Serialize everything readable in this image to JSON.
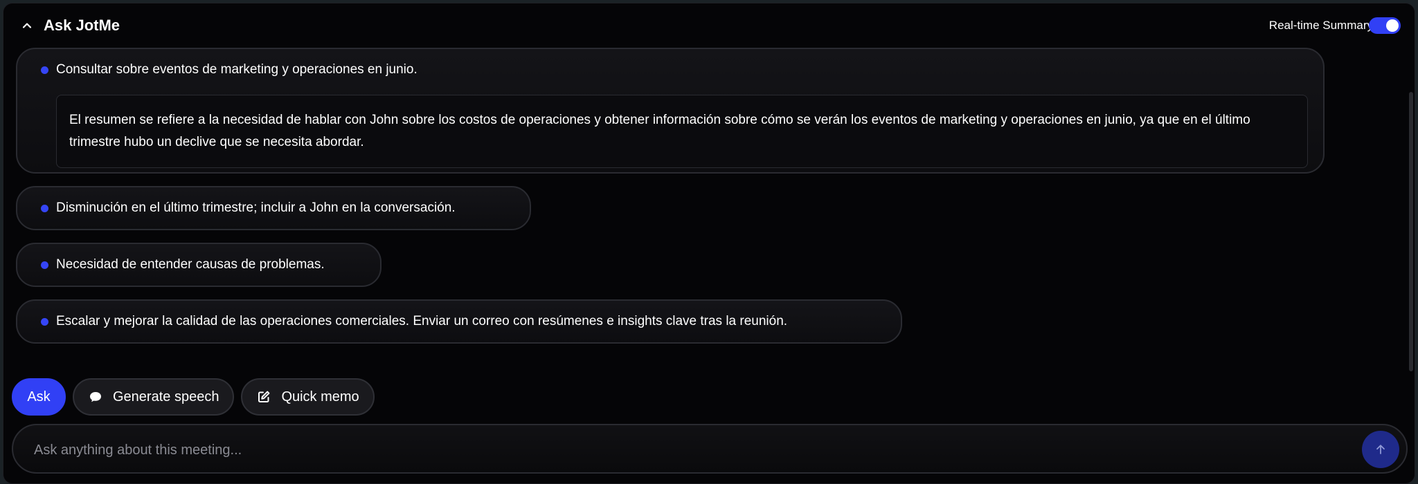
{
  "header": {
    "title": "Ask JotMe",
    "realtime_label": "Real-time Summary",
    "realtime_enabled": true
  },
  "summary": {
    "items": [
      {
        "label": "Consultar sobre eventos de marketing y operaciones en junio.",
        "detail": "El resumen se refiere a la necesidad de hablar con John sobre los costos de operaciones y obtener información sobre cómo se verán los eventos de marketing y operaciones en junio, ya que en el último trimestre hubo un declive que se necesita abordar."
      },
      {
        "label": "Disminución en el último trimestre; incluir a John en la conversación."
      },
      {
        "label": "Necesidad de entender causas de problemas."
      },
      {
        "label": "Escalar y mejorar la calidad de las operaciones comerciales. Enviar un correo con resúmenes e insights clave tras la reunión."
      }
    ]
  },
  "actions": {
    "ask_label": "Ask",
    "generate_speech_label": "Generate speech",
    "quick_memo_label": "Quick memo"
  },
  "input": {
    "placeholder": "Ask anything about this meeting...",
    "value": ""
  },
  "icons": {
    "collapse": "chevron-up-icon",
    "speech": "chat-bubble-icon",
    "memo": "edit-icon",
    "send": "arrow-up-icon"
  },
  "colors": {
    "accent": "#3140f5",
    "send_button": "#1f2a8a",
    "background": "#050507"
  }
}
